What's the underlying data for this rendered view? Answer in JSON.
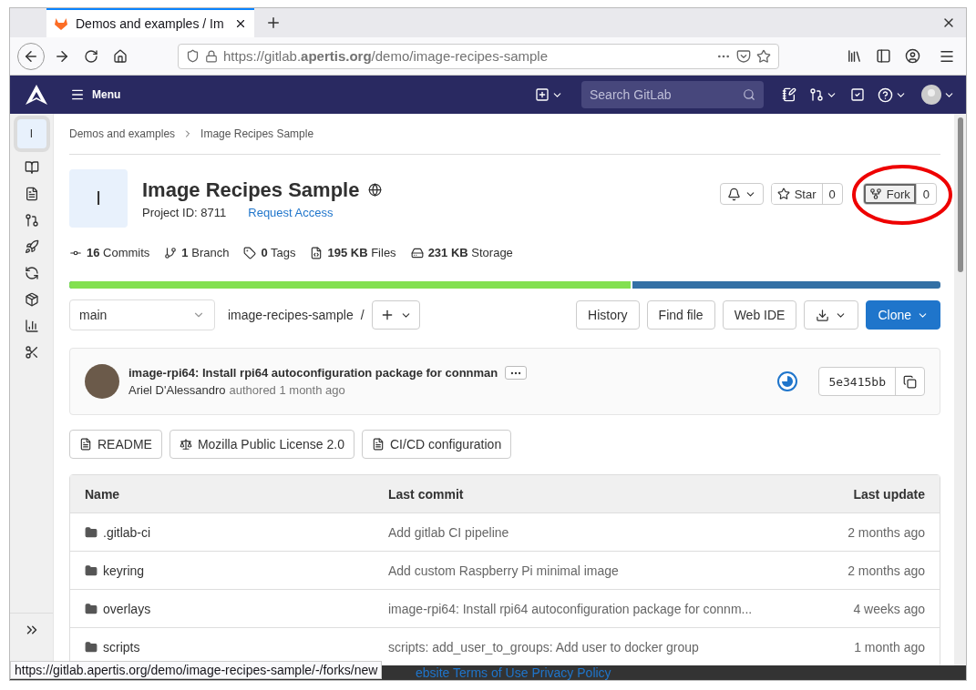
{
  "browser": {
    "tabs": [
      {
        "title": "Demos and examples / Im",
        "selected": true
      }
    ],
    "url": "https://gitlab.**apertis.org**/demo/image-recipes-sample"
  },
  "header": {
    "menu": "Menu",
    "search": {
      "placeholder": "Search GitLab"
    }
  },
  "sidebar": {
    "project_letter": "I"
  },
  "breadcrumbs": [
    "Demos and examples",
    "Image Recipes Sample"
  ],
  "project": {
    "letter": "I",
    "title": "Image Recipes Sample",
    "project_id": "Project ID: 8711",
    "request_access": "Request Access",
    "star": {
      "label": "Star",
      "count": "0"
    },
    "fork": {
      "label": "Fork",
      "count": "0",
      "focused": true
    }
  },
  "stats": [
    {
      "kind": "commits",
      "text": "**16** Commits"
    },
    {
      "kind": "branch",
      "text": "**1** Branch"
    },
    {
      "kind": "tags",
      "text": "**0** Tags"
    },
    {
      "kind": "files",
      "text": "**195 KB** Files"
    },
    {
      "kind": "storage",
      "text": "**231 KB** Storage"
    }
  ],
  "language_bar": {
    "level": 0.646
  },
  "tree": {
    "branch": "main",
    "path": "image-recipes-sample",
    "separator": "/",
    "buttons": [
      "History",
      "Find file",
      "Web IDE"
    ],
    "clone": "Clone"
  },
  "commit": {
    "title": "image-rpi64: Install rpi64 autoconfiguration package for connman",
    "author": "Ariel D'Alessandro",
    "meta": "authored 1 month ago",
    "sha": "5e3415bb"
  },
  "doc_buttons": [
    {
      "kind": "readme",
      "label": "README"
    },
    {
      "kind": "license",
      "label": "Mozilla Public License 2.0"
    },
    {
      "kind": "ci",
      "label": "CI/CD configuration"
    }
  ],
  "table": {
    "columns": [
      "Name",
      "Last commit",
      "Last update"
    ],
    "rows": [
      {
        "name": ".gitlab-ci",
        "commit": "Add gitlab CI pipeline",
        "updated": "2 months ago"
      },
      {
        "name": "keyring",
        "commit": "Add custom Raspberry Pi minimal image",
        "updated": "2 months ago"
      },
      {
        "name": "overlays",
        "commit": "image-rpi64: Install rpi64 autoconfiguration package for connm...",
        "updated": "4 weeks ago"
      },
      {
        "name": "scripts",
        "commit": "scripts: add_user_to_groups: Add user to docker group",
        "updated": "1 month ago"
      }
    ]
  },
  "footer": {
    "links": [
      "ebsite Terms of Use",
      "Privacy Policy"
    ]
  },
  "status_url": "https://gitlab.apertis.org/demo/image-recipes-sample/-/forks/new"
}
